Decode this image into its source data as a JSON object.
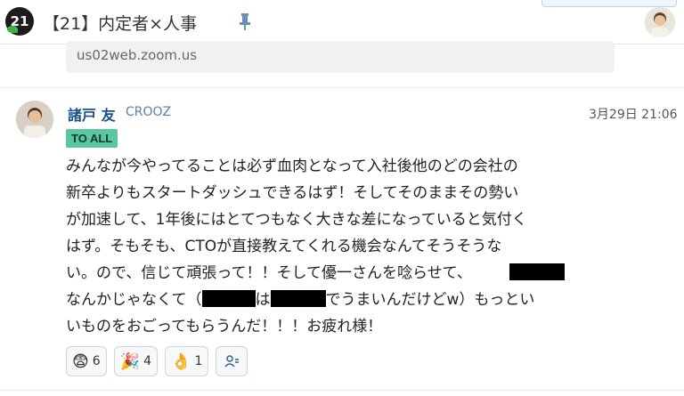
{
  "channel": {
    "badge_text": "21",
    "title": "【21】内定者×人事"
  },
  "link_preview": {
    "url": "us02web.zoom.us"
  },
  "message": {
    "sender": "諸戸 友",
    "organization": "CROOZ",
    "timestamp": "3月29日 21:06",
    "audience_badge": "TO ALL",
    "lines": {
      "l1": "みんなが今やってることは必ず血肉となって入社後他のどの会社の",
      "l2": "新卒よりもスタートダッシュできるはず！そしてそのままその勢い",
      "l3": "が加速して、1年後にはとてつもなく大きな差になっていると気付く",
      "l4": "はず。そもそも、CTOが直接教えてくれる機会なんてそうそうな",
      "l5": "い。ので、信じて頑張って！！そして優一さんを唸らせて、",
      "l6a": "なんかじゃなくて（",
      "l6b": "は",
      "l6c": "でうまいんだけどw）もっとい",
      "l7": "いものをおごってもらうんだ！！！お疲れ様！"
    }
  },
  "reactions": [
    {
      "icon": "grimace-emoji-icon",
      "glyph": "😨",
      "count": "6"
    },
    {
      "icon": "party-popper-icon",
      "glyph": "🎉",
      "count": "4"
    },
    {
      "icon": "ok-hand-icon",
      "glyph": "👌",
      "count": "1"
    }
  ],
  "colors": {
    "sender": "#1d4e89",
    "badge": "#5cc6a2",
    "accent_leaf": "#3fb24a"
  }
}
